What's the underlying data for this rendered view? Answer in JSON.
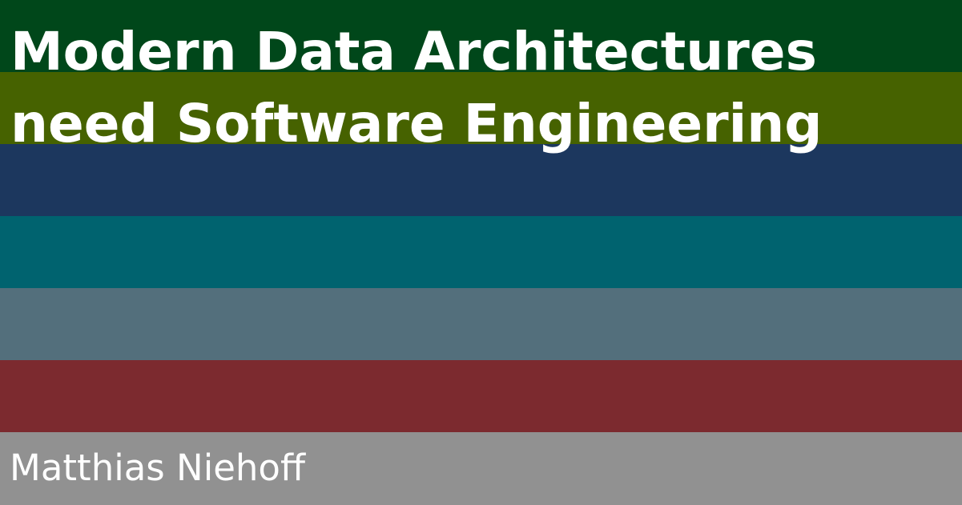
{
  "slide": {
    "title_lines": [
      "Modern Data Architectures",
      "need Software Engineering"
    ],
    "author": "Matthias Niehoff"
  },
  "stripes": [
    {
      "color": "#00471a"
    },
    {
      "color": "#466200"
    },
    {
      "color": "#1c375e"
    },
    {
      "color": "#00636f"
    },
    {
      "color": "#536f7c"
    },
    {
      "color": "#7c2a2f"
    },
    {
      "color": "#919191"
    }
  ]
}
